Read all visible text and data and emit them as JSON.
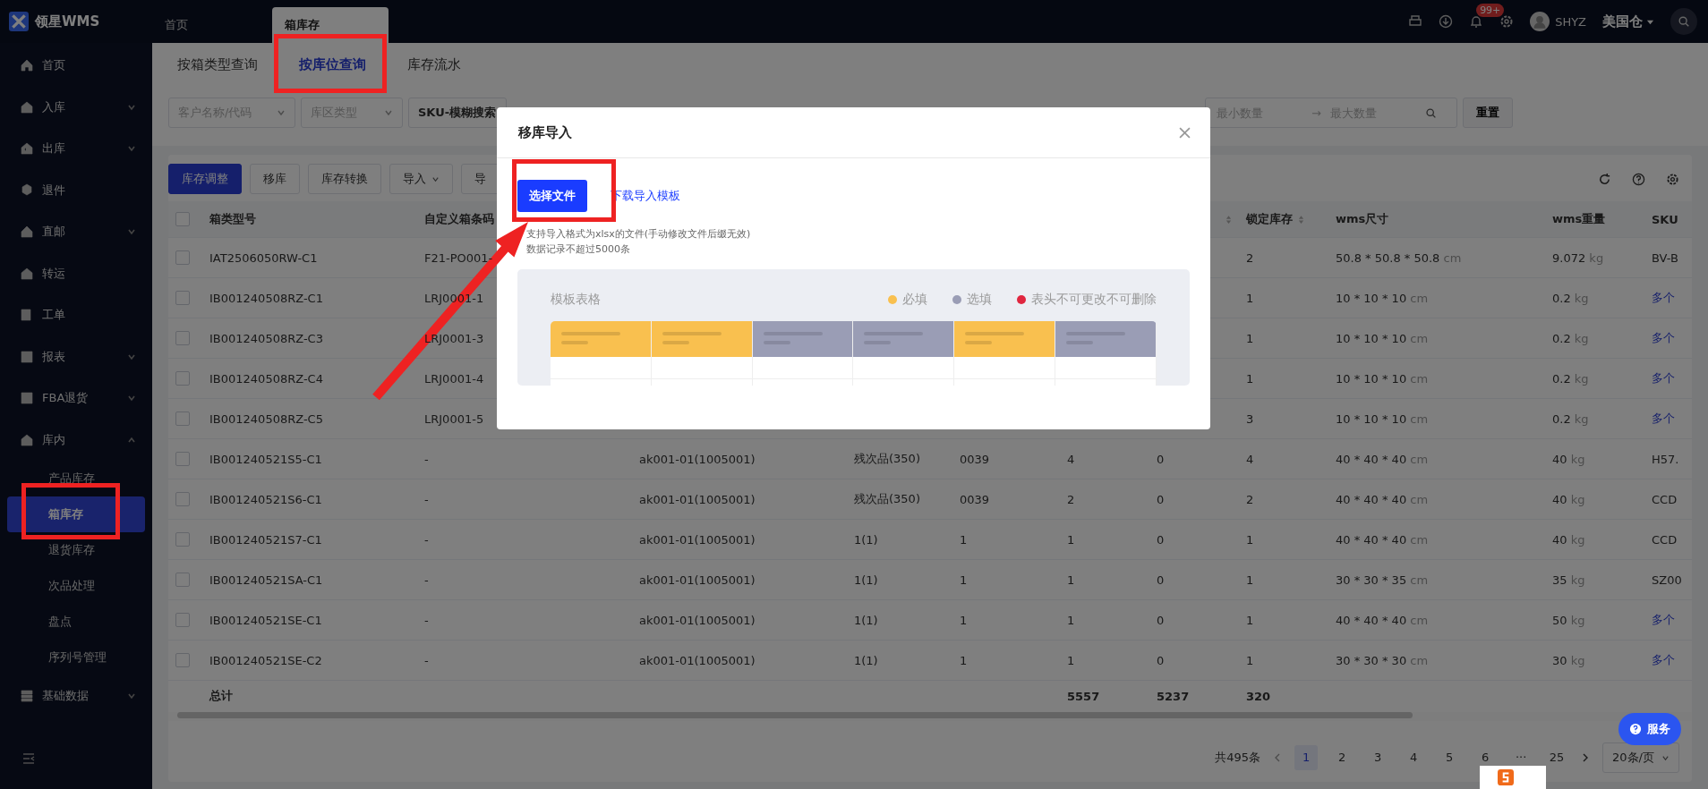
{
  "app": {
    "logo_text": "领星WMS",
    "tabs": [
      {
        "label": "首页",
        "selected": false
      },
      {
        "label": "箱库存",
        "selected": true
      }
    ],
    "notification_badge": "99+",
    "user": "SHYZ",
    "warehouse": "美国仓"
  },
  "sidebar": {
    "items": [
      {
        "label": "首页"
      },
      {
        "label": "入库",
        "expanded": false
      },
      {
        "label": "出库",
        "expanded": false
      },
      {
        "label": "退件"
      },
      {
        "label": "直邮",
        "expanded": false
      },
      {
        "label": "转运"
      },
      {
        "label": "工单"
      },
      {
        "label": "报表",
        "expanded": false
      },
      {
        "label": "FBA退货",
        "expanded": false
      },
      {
        "label": "库内",
        "expanded": true,
        "children": [
          {
            "label": "产品库存",
            "selected": false
          },
          {
            "label": "箱库存",
            "selected": true
          },
          {
            "label": "退货库存",
            "selected": false
          },
          {
            "label": "次品处理",
            "selected": false
          },
          {
            "label": "盘点",
            "selected": false
          },
          {
            "label": "序列号管理",
            "selected": false
          }
        ]
      },
      {
        "label": "基础数据",
        "expanded": false
      }
    ]
  },
  "page_tabs": [
    {
      "label": "按箱类型查询",
      "selected": false
    },
    {
      "label": "按库位查询",
      "selected": true
    },
    {
      "label": "库存流水",
      "selected": false
    }
  ],
  "filters": {
    "customer": {
      "placeholder": "客户名称/代码"
    },
    "zone_type": {
      "placeholder": "库区类型"
    },
    "sku_mode": "SKU-模糊搜索",
    "min_qty": {
      "placeholder": "最小数量"
    },
    "range_arrow": "→",
    "max_qty": {
      "placeholder": "最大数量"
    },
    "reset_button": "重置"
  },
  "toolbar": [
    {
      "label": "库存调整",
      "kind": "primary"
    },
    {
      "label": "移库",
      "kind": "plain"
    },
    {
      "label": "库存转换",
      "kind": "plain"
    },
    {
      "label": "导入",
      "kind": "dropdown"
    },
    {
      "label": "导",
      "kind": "plain"
    }
  ],
  "table": {
    "select_all_checked": false,
    "columns": [
      {
        "label": "箱类型号"
      },
      {
        "label": "自定义箱条码"
      },
      {},
      {},
      {},
      {},
      {
        "sortable": true
      },
      {
        "label": "锁定库存",
        "sortable": true
      },
      {
        "label": "wms尺寸"
      },
      {
        "label": "wms重量"
      },
      {
        "label": "SKU"
      }
    ],
    "rows": [
      {
        "checked": false,
        "box_type": "IAT2506050RW-C1",
        "custom_code": "F21-PO001-",
        "locked": "2",
        "size": "50.8 * 50.8 * 50.8",
        "size_unit": "cm",
        "weight": "9.072",
        "weight_unit": "kg",
        "sku": "BV-B",
        "sku_link": false
      },
      {
        "checked": false,
        "box_type": "IB001240508RZ-C1",
        "custom_code": "LRJ0001-1",
        "locked": "1",
        "size": "10 * 10 * 10",
        "size_unit": "cm",
        "weight": "0.2",
        "weight_unit": "kg",
        "sku": "多个",
        "sku_link": true
      },
      {
        "checked": false,
        "box_type": "IB001240508RZ-C3",
        "custom_code": "LRJ0001-3",
        "locked": "1",
        "size": "10 * 10 * 10",
        "size_unit": "cm",
        "weight": "0.2",
        "weight_unit": "kg",
        "sku": "多个",
        "sku_link": true
      },
      {
        "checked": false,
        "box_type": "IB001240508RZ-C4",
        "custom_code": "LRJ0001-4",
        "locked": "1",
        "size": "10 * 10 * 10",
        "size_unit": "cm",
        "weight": "0.2",
        "weight_unit": "kg",
        "sku": "多个",
        "sku_link": true
      },
      {
        "checked": false,
        "box_type": "IB001240508RZ-C5",
        "custom_code": "LRJ0001-5",
        "locked": "3",
        "size": "10 * 10 * 10",
        "size_unit": "cm",
        "weight": "0.2",
        "weight_unit": "kg",
        "sku": "多个",
        "sku_link": true
      },
      {
        "checked": false,
        "box_type": "IB001240521S5-C1",
        "custom_code": "-",
        "column_3": "ak001-01(1005001)",
        "column_4": "残次品(350)",
        "column_5": "0039",
        "column_6": "4",
        "column_7": "0",
        "locked": "4",
        "size": "40 * 40 * 40",
        "size_unit": "cm",
        "weight": "40",
        "weight_unit": "kg",
        "sku": "H57.",
        "sku_link": false
      },
      {
        "checked": false,
        "box_type": "IB001240521S6-C1",
        "custom_code": "-",
        "column_3": "ak001-01(1005001)",
        "column_4": "残次品(350)",
        "column_5": "0039",
        "column_6": "2",
        "column_7": "0",
        "locked": "2",
        "size": "40 * 40 * 40",
        "size_unit": "cm",
        "weight": "40",
        "weight_unit": "kg",
        "sku": "CCD",
        "sku_link": false
      },
      {
        "checked": false,
        "box_type": "IB001240521S7-C1",
        "custom_code": "-",
        "column_3": "ak001-01(1005001)",
        "column_4": "1(1)",
        "column_5": "1",
        "column_6": "1",
        "column_7": "0",
        "locked": "1",
        "size": "40 * 40 * 40",
        "size_unit": "cm",
        "weight": "40",
        "weight_unit": "kg",
        "sku": "CCD",
        "sku_link": false
      },
      {
        "checked": false,
        "box_type": "IB001240521SA-C1",
        "custom_code": "-",
        "column_3": "ak001-01(1005001)",
        "column_4": "1(1)",
        "column_5": "1",
        "column_6": "1",
        "column_7": "0",
        "locked": "1",
        "size": "30 * 30 * 35",
        "size_unit": "cm",
        "weight": "35",
        "weight_unit": "kg",
        "sku": "SZ00",
        "sku_link": false
      },
      {
        "checked": false,
        "box_type": "IB001240521SE-C1",
        "custom_code": "-",
        "column_3": "ak001-01(1005001)",
        "column_4": "1(1)",
        "column_5": "1",
        "column_6": "1",
        "column_7": "0",
        "locked": "1",
        "size": "40 * 40 * 40",
        "size_unit": "cm",
        "weight": "50",
        "weight_unit": "kg",
        "sku": "多个",
        "sku_link": true
      },
      {
        "checked": false,
        "box_type": "IB001240521SE-C2",
        "custom_code": "-",
        "column_3": "ak001-01(1005001)",
        "column_4": "1(1)",
        "column_5": "1",
        "column_6": "1",
        "column_7": "0",
        "locked": "1",
        "size": "30 * 30 * 30",
        "size_unit": "cm",
        "weight": "30",
        "weight_unit": "kg",
        "sku": "多个",
        "sku_link": true
      }
    ],
    "totals": {
      "box_type": "总计",
      "column_6": "5557",
      "column_7": "5237",
      "locked": "320"
    }
  },
  "pagination": {
    "total": "共495条",
    "pages": [
      {
        "label": "1",
        "selected": true
      },
      {
        "label": "2",
        "selected": false
      },
      {
        "label": "3",
        "selected": false
      },
      {
        "label": "4",
        "selected": false
      },
      {
        "label": "5",
        "selected": false
      },
      {
        "label": "6",
        "selected": false
      },
      {
        "label": "···",
        "selected": false
      },
      {
        "label": "25",
        "selected": false
      }
    ],
    "page_size": "20条/页"
  },
  "service_button": "服务",
  "modal": {
    "title": "移库导入",
    "select_button": "选择文件",
    "template_link": "下载导入模板",
    "notes": [
      "支持导入格式为xlsx的文件(手动修改文件后缀无效)",
      "数据记录不超过5000条"
    ],
    "template": {
      "title": "模板表格",
      "legend": [
        {
          "label": "必填",
          "color": "#f9c04f"
        },
        {
          "label": "选填",
          "color": "#9a9db5"
        },
        {
          "label": "表头不可更改不可删除",
          "color": "#e0263f"
        }
      ],
      "columns": [
        {
          "kind": "required"
        },
        {
          "kind": "required"
        },
        {
          "kind": "optional"
        },
        {
          "kind": "optional"
        },
        {
          "kind": "required"
        },
        {
          "kind": "optional"
        }
      ]
    }
  }
}
